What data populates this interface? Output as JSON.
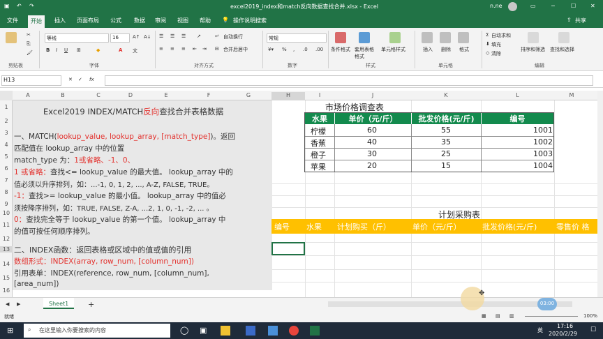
{
  "title": {
    "window_title": "excel2019_index和match反向数据查找合并.xlsx - Excel",
    "user": "n.ne",
    "share": "共享"
  },
  "tabs": [
    "文件",
    "开始",
    "插入",
    "页面布局",
    "公式",
    "数据",
    "审阅",
    "视图",
    "帮助",
    "操作说明搜索"
  ],
  "ribbon": {
    "font_name": "等线",
    "font_size": "16",
    "wrap_text": "自动换行",
    "merge_center": "合并后居中",
    "number_format": "常规",
    "cond_format": "条件格式",
    "table_format": "套用表格格式",
    "cell_style": "单元格样式",
    "insert": "插入",
    "delete": "删除",
    "format": "格式",
    "autosum": "自动求和",
    "fill": "填充",
    "clear": "清除",
    "sort_filter": "排序和筛选",
    "find_select": "查找和选择",
    "groups": [
      "剪贴板",
      "字体",
      "对齐方式",
      "数字",
      "样式",
      "单元格",
      "编辑"
    ]
  },
  "formula_bar": {
    "name_box": "H13",
    "fx": "fx",
    "content": ""
  },
  "columns": [
    "A",
    "B",
    "C",
    "D",
    "E",
    "F",
    "G",
    "H",
    "I",
    "J",
    "K",
    "L",
    "M"
  ],
  "rows": [
    "1",
    "2",
    "3",
    "4",
    "5",
    "6",
    "7",
    "8",
    "9",
    "10",
    "11",
    "12",
    "13",
    "14",
    "15",
    "16"
  ],
  "textbox": {
    "title_a": "Excel2019 INDEX/MATCH",
    "title_red": "反向",
    "title_b": "查找合并表格数据",
    "l1a": "一、MATCH(",
    "l1red": "lookup_value, lookup_array, [match_type]",
    "l1b": ")。返回",
    "l2": "匹配值在 lookup_array 中的位置",
    "l3a": "match_type 为：",
    "l3red": "1或省略、-1、0、",
    "l4red": "1 或省略：",
    "l4b": "查找<= lookup_value 的最大值。 lookup_array 中的",
    "l5": "值必须以升序排列，如：...-1, 0, 1, 2, ..., A-Z, FALSE, TRUE。",
    "l6red": "-1：",
    "l6b": "查找>= lookup_value 的最小值。 lookup_array 中的值必",
    "l7": "须按降序排列，如：TRUE, FALSE, Z-A, ...2, 1, 0, -1, -2, ... 。",
    "l8red": "0：",
    "l8b": "查找完全等于 lookup_value 的第一个值。 lookup_array 中",
    "l9": "的值可按任何顺序排列。",
    "l10": "二、INDEX函数：返回表格或区域中的值或值的引用",
    "l11red": "数组形式：INDEX(array, row_num, [column_num])",
    "l12": "引用表单：INDEX(reference, row_num, [column_num],",
    "l13": "[area_num])"
  },
  "market_table": {
    "title": "市场价格调查表",
    "headers": [
      "水果",
      "单价（元/斤）",
      "批发价格(元/斤)",
      "编号"
    ],
    "rows": [
      [
        "柠檬",
        "60",
        "55",
        "1001"
      ],
      [
        "香蕉",
        "40",
        "35",
        "1002"
      ],
      [
        "橙子",
        "30",
        "25",
        "1003"
      ],
      [
        "苹果",
        "20",
        "15",
        "1004"
      ]
    ]
  },
  "plan_table": {
    "title": "计划采购表",
    "headers": [
      "编号",
      "水果",
      "计划购买（斤）",
      "单价（元/斤）",
      "批发价格(元/斤)",
      "零售价 格"
    ]
  },
  "sheet": {
    "tab": "Sheet1",
    "add": "+"
  },
  "status": {
    "ready": "就绪",
    "zoom": "100%",
    "badge": "03:00"
  },
  "taskbar": {
    "search": "在这里输入你要搜索的内容",
    "time": "17:16",
    "date": "2020/2/29",
    "lang": "英"
  },
  "colors": {
    "excel_green": "#217346",
    "header_green": "#138a4d",
    "header_orange": "#ffc000",
    "red_text": "#e3312d"
  }
}
